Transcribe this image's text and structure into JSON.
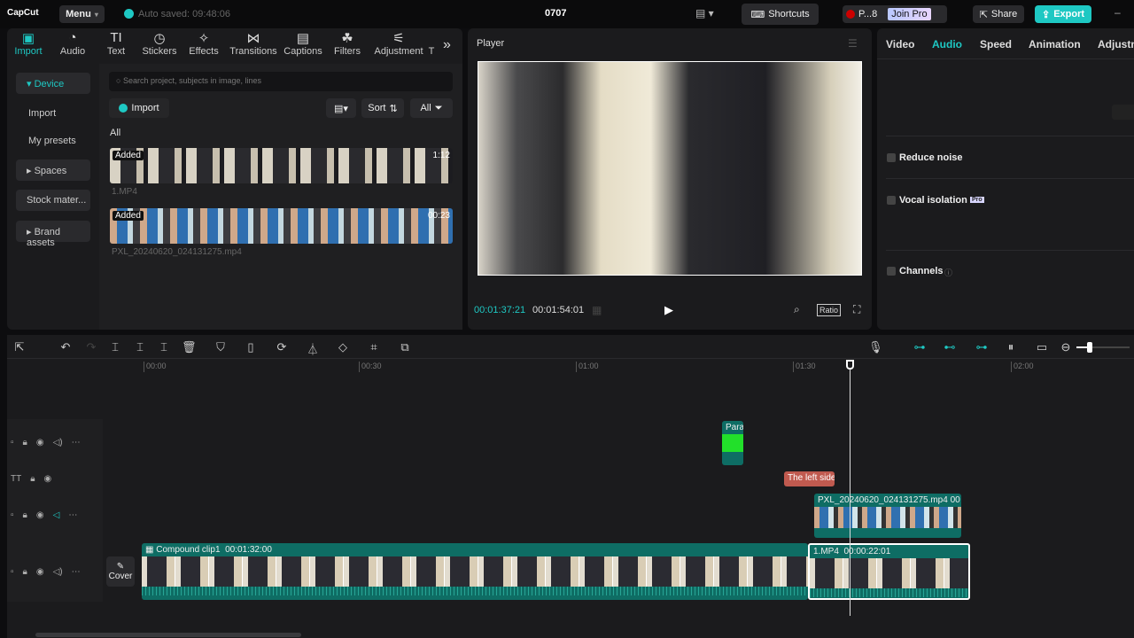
{
  "app": {
    "logo": "CapCut",
    "menu": "Menu",
    "autosave": "Auto saved: 09:48:06",
    "project_title": "0707",
    "shortcuts": "Shortcuts",
    "profile": "P...8",
    "join_pro": "Join Pro",
    "share": "Share",
    "export": "Export",
    "accent": "#1ec8c3"
  },
  "media_tabs": [
    {
      "label": "Import",
      "icon": "import-icon"
    },
    {
      "label": "Audio",
      "icon": "audio-icon"
    },
    {
      "label": "Text",
      "icon": "text-icon"
    },
    {
      "label": "Stickers",
      "icon": "sticker-icon"
    },
    {
      "label": "Effects",
      "icon": "effects-icon"
    },
    {
      "label": "Transitions",
      "icon": "transitions-icon"
    },
    {
      "label": "Captions",
      "icon": "captions-icon"
    },
    {
      "label": "Filters",
      "icon": "filters-icon"
    },
    {
      "label": "Adjustment",
      "icon": "adjustment-icon"
    },
    {
      "label": "T"
    }
  ],
  "sidebar": {
    "items": [
      "Device",
      "Import",
      "My presets",
      "Spaces",
      "Stock mater...",
      "Brand assets"
    ]
  },
  "media": {
    "search_placeholder": "Search project, subjects in image, lines",
    "import": "Import",
    "sort": "Sort",
    "all_filter": "All",
    "section": "All",
    "items": [
      {
        "name": "1.MP4",
        "badge": "Added",
        "duration": "1:12"
      },
      {
        "name": "PXL_20240620_024131275.mp4",
        "badge": "Added",
        "duration": "00:23"
      }
    ]
  },
  "player": {
    "title": "Player",
    "current": "00:01:37:21",
    "total": "00:01:54:01",
    "ratio": "Ratio"
  },
  "inspector": {
    "tabs": [
      "Video",
      "Audio",
      "Speed",
      "Animation",
      "Adjustm"
    ],
    "active": "Audio",
    "options": [
      "Reduce noise",
      "Vocal isolation",
      "Channels"
    ],
    "pro": "Pro"
  },
  "timeline": {
    "ruler": [
      "00:00",
      "00:30",
      "01:00",
      "01:30",
      "02:00"
    ],
    "cover": "Cover",
    "clips": {
      "sticker": "Para",
      "text": "The left side",
      "pip": "PXL_20240620_024131275.mp4  00",
      "compound": "Compound clip1",
      "compound_dur": "00:01:32:00",
      "main2": "1.MP4",
      "main2_dur": "00:00:22:01"
    }
  }
}
